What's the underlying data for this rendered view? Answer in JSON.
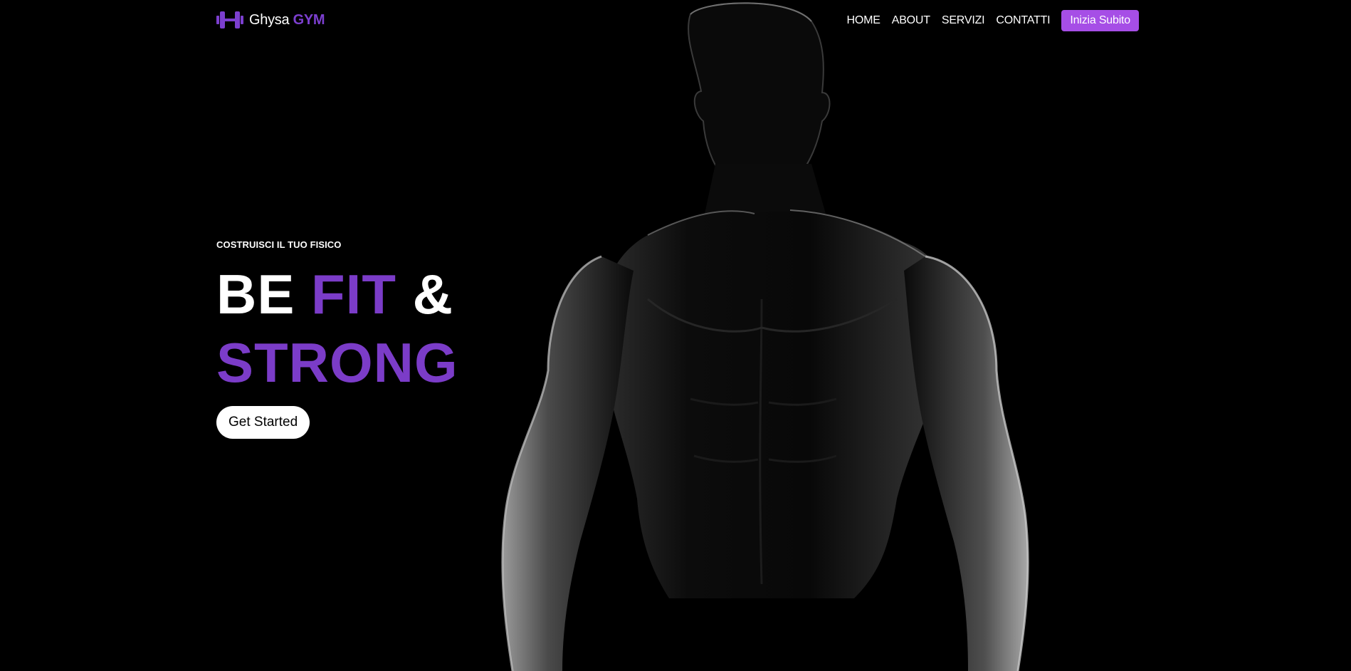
{
  "brand": {
    "icon": "dumbbell-icon",
    "name": "Ghysa",
    "accent": "GYM",
    "accent_color": "#7c3fcf"
  },
  "nav": {
    "links": [
      "HOME",
      "ABOUT",
      "SERVIZI",
      "CONTATTI"
    ],
    "cta_label": "Inizia Subito",
    "cta_color": "#a64ee6"
  },
  "hero": {
    "eyebrow": "COSTRUISCI IL TUO FISICO",
    "headline": {
      "word1": "BE",
      "word2": "FIT",
      "word3": "&",
      "word4": "STRONG"
    },
    "headline_accent_color": "#7b3cc8",
    "button_label": "Get Started",
    "image": "muscular-man-silhouette"
  },
  "colors": {
    "background": "#000000",
    "text": "#ffffff"
  }
}
